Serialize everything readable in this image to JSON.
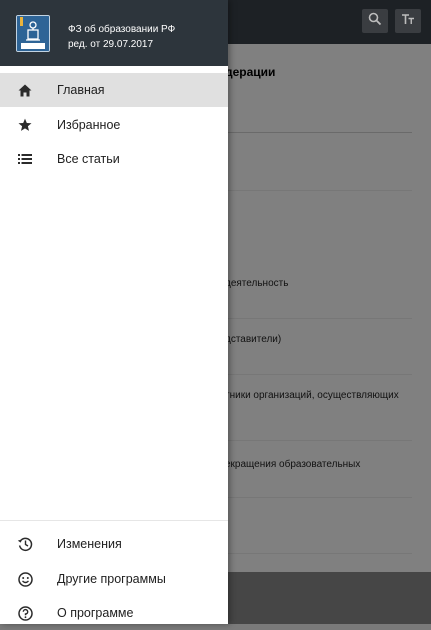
{
  "header": {
    "title": "ФЗ об образовании РФ",
    "subtitle": "ред. от 29.07.2017",
    "logo_icon": "law-book-icon"
  },
  "menu": {
    "top_items": [
      {
        "label": "Главная",
        "icon": "home-icon",
        "active": true
      },
      {
        "label": "Избранное",
        "icon": "star-icon",
        "active": false
      },
      {
        "label": "Все статьи",
        "icon": "list-icon",
        "active": false
      }
    ],
    "bottom_items": [
      {
        "label": "Изменения",
        "icon": "history-icon"
      },
      {
        "label": "Другие программы",
        "icon": "smiley-icon"
      },
      {
        "label": "О программе",
        "icon": "help-icon"
      }
    ]
  },
  "background": {
    "toolbar_icons": [
      "search-icon",
      "text-size-icon"
    ],
    "heading": "дерации",
    "lines": [
      "деятельность",
      "дставители)",
      "тники организаций, осуществляющих",
      "екращения образовательных"
    ]
  },
  "colors": {
    "drawer_header": "#2d353c",
    "active_item": "#e0e0e0",
    "toolbar": "#1d2125",
    "scrim_content": "#808080"
  }
}
